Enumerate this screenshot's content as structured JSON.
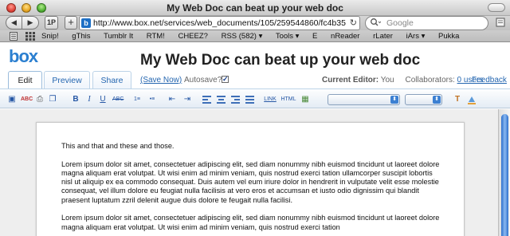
{
  "window": {
    "title": "My Web Doc can beat up your web doc"
  },
  "browser": {
    "back_glyph": "◀",
    "forward_glyph": "▶",
    "onepassword_label": "1P",
    "add_glyph": "+",
    "favicon_glyph": "b",
    "url": "http://www.box.net/services/web_documents/105/259544860/fc4b35",
    "reload_glyph": "↻",
    "search_placeholder": "Google",
    "search_glyph": "🔍",
    "page_menu_glyph": "▭"
  },
  "bookmarks": [
    "Snip!",
    "gThis",
    "Tumblr It",
    "RTM!",
    "CHEEZ?",
    "RSS (582) ▾",
    "Tools ▾",
    "E",
    "nReader",
    "rLater",
    "iArs ▾",
    "Pukka"
  ],
  "app": {
    "logo": "box",
    "doc_title": "My Web Doc can beat up your web doc",
    "tabs": [
      "Edit",
      "Preview",
      "Share"
    ],
    "save_now": "(Save Now)",
    "autosave_label": "Autosave?",
    "autosave_checked": true,
    "check_glyph": "✓",
    "current_editor_label": "Current Editor:",
    "current_editor_value": "You",
    "collaborators_label": "Collaborators:",
    "collaborators_link": "0 users",
    "feedback": "Feedback"
  },
  "editor_toolbar": {
    "save_glyph": "▣",
    "spell_glyph": "ABC",
    "print_glyph": "⎙",
    "copy_glyph": "❐",
    "bold": "B",
    "italic": "I",
    "underline": "U",
    "strike": "ABC",
    "list_ol": "1≡",
    "list_ul": "•≡",
    "outdent": "⇤",
    "indent": "⇥",
    "link": "LINK",
    "html": "HTML",
    "image_glyph": "▦",
    "color_text": "T",
    "font_select_value": "",
    "size_select_value": "",
    "select_arrow": "⬍"
  },
  "document": {
    "paragraphs": [
      "This and that and these and those.",
      "Lorem ipsum dolor sit amet, consectetuer adipiscing elit, sed diam nonummy nibh euismod tincidunt ut laoreet dolore magna aliquam erat volutpat. Ut wisi enim ad minim veniam, quis nostrud exerci tation ullamcorper suscipit lobortis nisl ut aliquip ex ea commodo consequat. Duis autem vel eum iriure dolor in hendrerit in vulputate velit esse molestie consequat, vel illum dolore eu feugiat nulla facilisis at vero eros et accumsan et iusto odio dignissim qui blandit praesent luptatum zzril delenit augue duis dolore te feugait nulla facilisi.",
      "Lorem ipsum dolor sit amet, consectetuer adipiscing elit, sed diam nonummy nibh euismod tincidunt ut laoreet dolore magna aliquam erat volutpat. Ut wisi enim ad minim veniam, quis nostrud exerci tation"
    ]
  }
}
